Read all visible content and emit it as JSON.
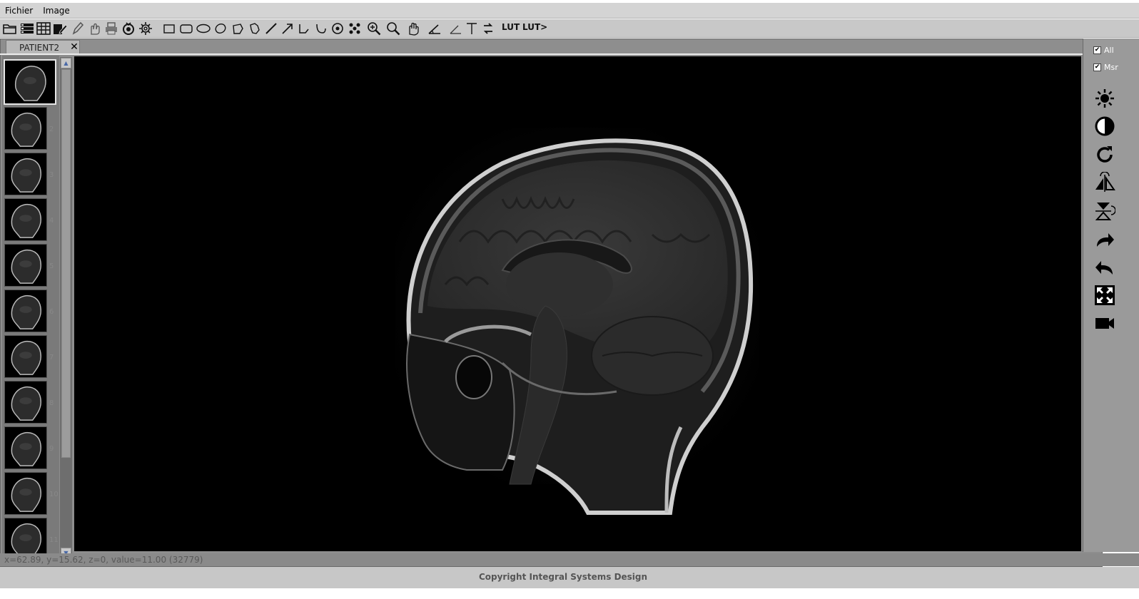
{
  "menubar": {
    "items": [
      "Fichier",
      "Image"
    ]
  },
  "toolbar": {
    "icons": [
      "open-folder-icon",
      "list-icon",
      "table-icon",
      "edit-doc-icon",
      "pen-icon",
      "hand-select-icon",
      "print-icon",
      "anonymize-icon",
      "settings-gear-icon",
      "rectangle-tool-icon",
      "rounded-rect-tool-icon",
      "ellipse-tool-icon",
      "freehand-ellipse-tool-icon",
      "polygon-tool-icon",
      "freehand-polygon-tool-icon",
      "line-tool-icon",
      "arrow-tool-icon",
      "polyline-tool-icon",
      "curve-tool-icon",
      "point-tool-icon",
      "dots-tool-icon",
      "zoom-in-icon",
      "magnifier-icon",
      "pan-hand-icon",
      "angle-tool-icon",
      "cobb-angle-tool-icon",
      "text-tool-icon",
      "transfer-icon"
    ],
    "lut_label": "LUT",
    "lut_next_label": "LUT>"
  },
  "tabs": [
    {
      "label": "PATIENT2",
      "close": "✕"
    }
  ],
  "thumbnails": {
    "numbers": [
      "2",
      "3",
      "4",
      "5",
      "6",
      "7",
      "8",
      "9",
      "10",
      "11"
    ]
  },
  "right_panel": {
    "checks": [
      {
        "label": "All",
        "checked": true
      },
      {
        "label": "Msr",
        "checked": true
      }
    ],
    "tools": [
      "brightness-icon",
      "contrast-icon",
      "rotate-icon",
      "flip-horizontal-icon",
      "flip-vertical-icon",
      "redo-icon",
      "undo-icon",
      "fullscreen-icon",
      "video-camera-icon"
    ]
  },
  "status": {
    "coords": "x=62.89, y=15.62, z=0, value=11.00 (32779)"
  },
  "footer": {
    "copyright": "Copyright Integral Systems Design"
  }
}
